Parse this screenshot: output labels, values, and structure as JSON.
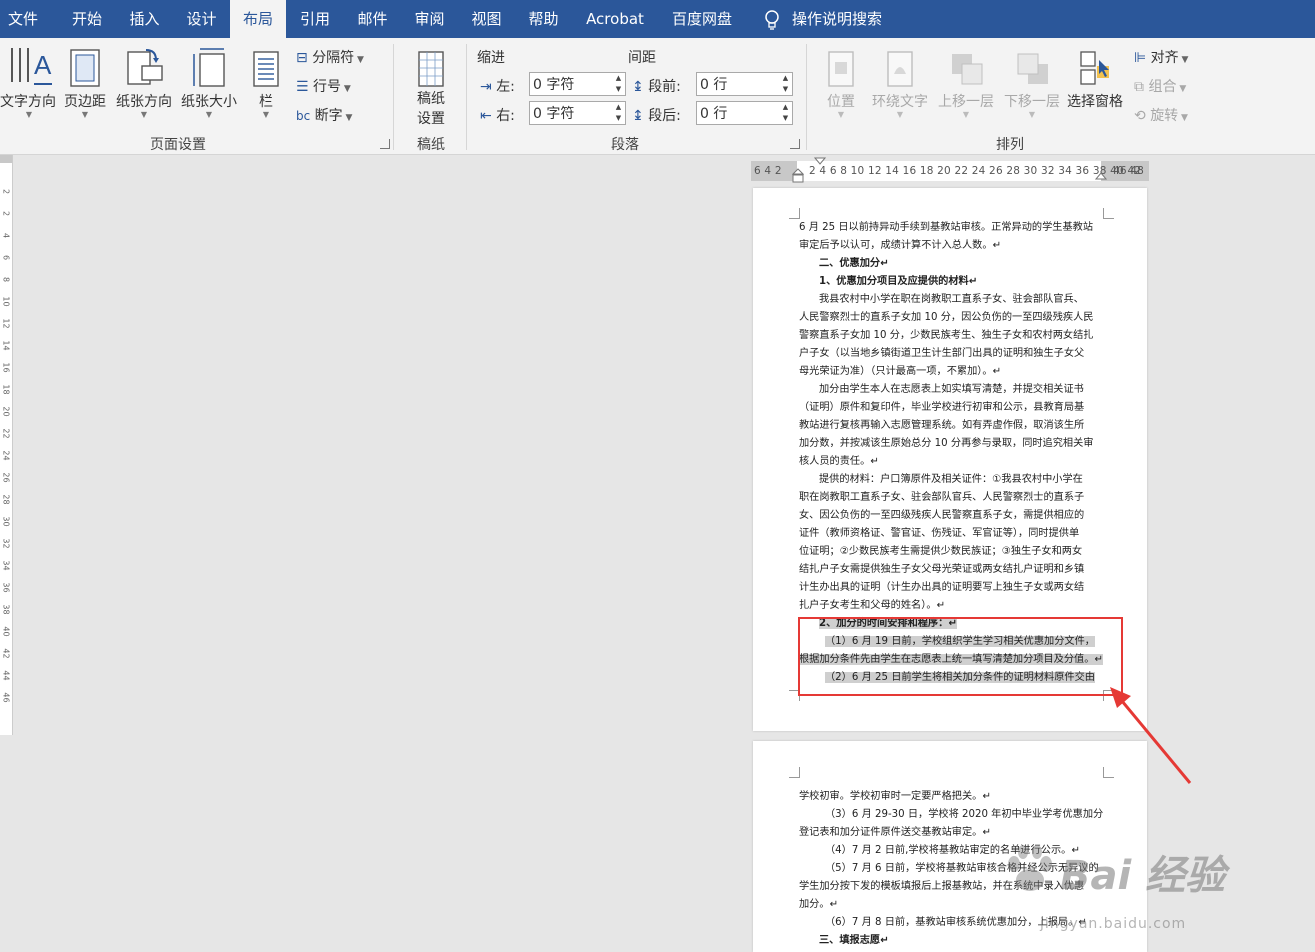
{
  "menu": {
    "tabs": [
      "文件",
      "开始",
      "插入",
      "设计",
      "布局",
      "引用",
      "邮件",
      "审阅",
      "视图",
      "帮助",
      "Acrobat",
      "百度网盘"
    ],
    "active": "布局",
    "search_label": "操作说明搜索"
  },
  "ribbon": {
    "page_setup": {
      "text_direction": "文字方向",
      "margins": "页边距",
      "orientation": "纸张方向",
      "size": "纸张大小",
      "columns": "栏",
      "breaks": "分隔符",
      "line_numbers": "行号",
      "hyphenation": "断字",
      "group_label": "页面设置"
    },
    "manuscript": {
      "button": "稿纸设置",
      "button_line1": "稿纸",
      "button_line2": "设置",
      "group_label": "稿纸"
    },
    "paragraph": {
      "indent_label": "缩进",
      "spacing_label": "间距",
      "left_label": "左:",
      "right_label": "右:",
      "before_label": "段前:",
      "after_label": "段后:",
      "left_value": "0 字符",
      "right_value": "0 字符",
      "before_value": "0 行",
      "after_value": "0 行",
      "group_label": "段落"
    },
    "arrange": {
      "position": "位置",
      "wrap_text": "环绕文字",
      "bring_forward": "上移一层",
      "send_backward": "下移一层",
      "selection_pane": "选择窗格",
      "align": "对齐",
      "group": "组合",
      "rotate": "旋转",
      "group_label": "排列"
    }
  },
  "ruler": {
    "left_numbers": "6  4  2",
    "main_numbers": "2  4  6  8 10 12 14 16 18 20 22 24 26 28 30 32 34 36 38 40 42",
    "right_numbers": "46 48",
    "vertical_numbers": [
      "2",
      "2",
      "4",
      "6",
      "8",
      "10",
      "12",
      "14",
      "16",
      "18",
      "20",
      "22",
      "24",
      "26",
      "28",
      "30",
      "32",
      "34",
      "36",
      "38",
      "40",
      "42",
      "44",
      "46"
    ]
  },
  "page1_lines": [
    {
      "text": "6 月 25 日以前持异动手续到基教站审核。正常异动的学生基教站",
      "bold": false,
      "indent": 0,
      "hl": false
    },
    {
      "text": "审定后予以认可，成绩计算不计入总人数。↵",
      "bold": false,
      "indent": 0,
      "hl": false
    },
    {
      "text": "二、优惠加分↵",
      "bold": true,
      "indent": 20,
      "hl": false
    },
    {
      "text": "1、优惠加分项目及应提供的材料↵",
      "bold": true,
      "indent": 20,
      "hl": false
    },
    {
      "text": "我县农村中小学在职在岗教职工直系子女、驻会部队官兵、",
      "bold": false,
      "indent": 20,
      "hl": false
    },
    {
      "text": "人民警察烈士的直系子女加 10 分，因公负伤的一至四级残疾人民",
      "bold": false,
      "indent": 0,
      "hl": false
    },
    {
      "text": "警察直系子女加 10 分，少数民族考生、独生子女和农村两女结扎",
      "bold": false,
      "indent": 0,
      "hl": false
    },
    {
      "text": "户子女（以当地乡镇街道卫生计生部门出具的证明和独生子女父",
      "bold": false,
      "indent": 0,
      "hl": false
    },
    {
      "text": "母光荣证为准）（只计最高一项，不累加）。↵",
      "bold": false,
      "indent": 0,
      "hl": false
    },
    {
      "text": "加分由学生本人在志愿表上如实填写清楚，并提交相关证书",
      "bold": false,
      "indent": 20,
      "hl": false
    },
    {
      "text": "（证明）原件和复印件，毕业学校进行初审和公示，县教育局基",
      "bold": false,
      "indent": 0,
      "hl": false
    },
    {
      "text": "教站进行复核再输入志愿管理系统。如有弄虚作假，取消该生所",
      "bold": false,
      "indent": 0,
      "hl": false
    },
    {
      "text": "加分数，并按减该生原始总分 10 分再参与录取，同时追究相关审",
      "bold": false,
      "indent": 0,
      "hl": false
    },
    {
      "text": "核人员的责任。↵",
      "bold": false,
      "indent": 0,
      "hl": false
    },
    {
      "text": "提供的材料：户口簿原件及相关证件：①我县农村中小学在",
      "bold": false,
      "indent": 20,
      "hl": false
    },
    {
      "text": "职在岗教职工直系子女、驻会部队官兵、人民警察烈士的直系子",
      "bold": false,
      "indent": 0,
      "hl": false
    },
    {
      "text": "女、因公负伤的一至四级残疾人民警察直系子女，需提供相应的",
      "bold": false,
      "indent": 0,
      "hl": false
    },
    {
      "text": "证件（教师资格证、警官证、伤残证、军官证等），同时提供单",
      "bold": false,
      "indent": 0,
      "hl": false
    },
    {
      "text": "位证明；②少数民族考生需提供少数民族证；③独生子女和两女",
      "bold": false,
      "indent": 0,
      "hl": false
    },
    {
      "text": "结扎户子女需提供独生子女父母光荣证或两女结扎户证明和乡镇",
      "bold": false,
      "indent": 0,
      "hl": false
    },
    {
      "text": "计生办出具的证明（计生办出具的证明要写上独生子女或两女结",
      "bold": false,
      "indent": 0,
      "hl": false
    },
    {
      "text": "扎户子女考生和父母的姓名）。↵",
      "bold": false,
      "indent": 0,
      "hl": false
    },
    {
      "text": "2、加分的时间安排和程序：↵",
      "bold": true,
      "indent": 20,
      "hl": true
    },
    {
      "text": "（1）6 月 19 日前，学校组织学生学习相关优惠加分文件，",
      "bold": false,
      "indent": 26,
      "hl": true
    },
    {
      "text": "根据加分条件先由学生在志愿表上统一填写清楚加分项目及分值。↵",
      "bold": false,
      "indent": 0,
      "hl": true
    },
    {
      "text": "（2）6 月 25 日前学生将相关加分条件的证明材料原件交由",
      "bold": false,
      "indent": 26,
      "hl": true
    }
  ],
  "page2_lines": [
    {
      "text": "学校初审。学校初审时一定要严格把关。↵",
      "bold": false,
      "indent": 0,
      "hl": false
    },
    {
      "text": "（3）6 月 29-30 日，学校将 2020 年初中毕业学考优惠加分",
      "bold": false,
      "indent": 26,
      "hl": false
    },
    {
      "text": "登记表和加分证件原件送交基教站审定。↵",
      "bold": false,
      "indent": 0,
      "hl": false
    },
    {
      "text": "（4）7 月 2 日前,学校将基教站审定的名单进行公示。↵",
      "bold": false,
      "indent": 26,
      "hl": false
    },
    {
      "text": "（5）7 月 6 日前，学校将基教站审核合格并经公示无异议的",
      "bold": false,
      "indent": 26,
      "hl": false
    },
    {
      "text": "学生加分按下发的模板填报后上报基教站，并在系统中录入优惠",
      "bold": false,
      "indent": 0,
      "hl": false
    },
    {
      "text": "加分。↵",
      "bold": false,
      "indent": 0,
      "hl": false
    },
    {
      "text": "（6）7 月 8 日前，基教站审核系统优惠加分，上报局。↵",
      "bold": false,
      "indent": 26,
      "hl": false
    },
    {
      "text": "三、填报志愿↵",
      "bold": true,
      "indent": 20,
      "hl": false
    }
  ],
  "watermark": {
    "logo": "Bai 经验",
    "url": "jingyan.baidu.com"
  }
}
